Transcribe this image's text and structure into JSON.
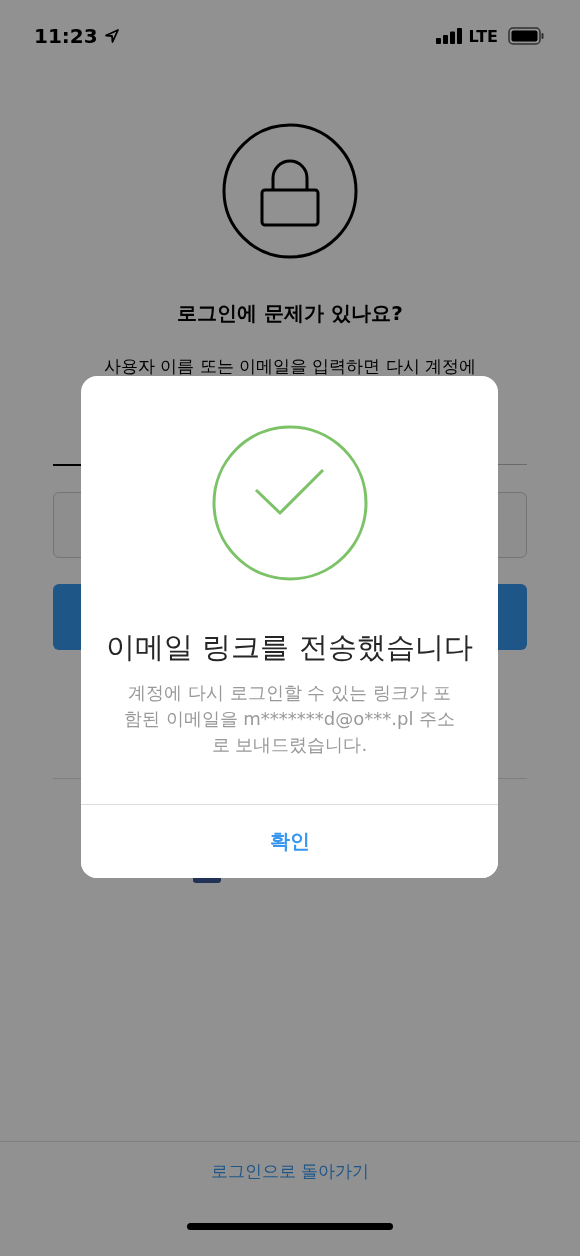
{
  "status_bar": {
    "time": "11:23",
    "network": "LTE"
  },
  "header": {
    "title": "로그인에 문제가 있나요?",
    "subtitle": "사용자 이름 또는 이메일을 입력하면 다시 계정에"
  },
  "dialog": {
    "title": "이메일 링크를 전송했습니다",
    "message": "계정에 다시 로그인할 수 있는 링크가 포함된 이메일을 m*******d@o***.pl 주소로 보내드렸습니다.",
    "button": "확인"
  },
  "footer": {
    "link": "로그인으로 돌아가기"
  }
}
